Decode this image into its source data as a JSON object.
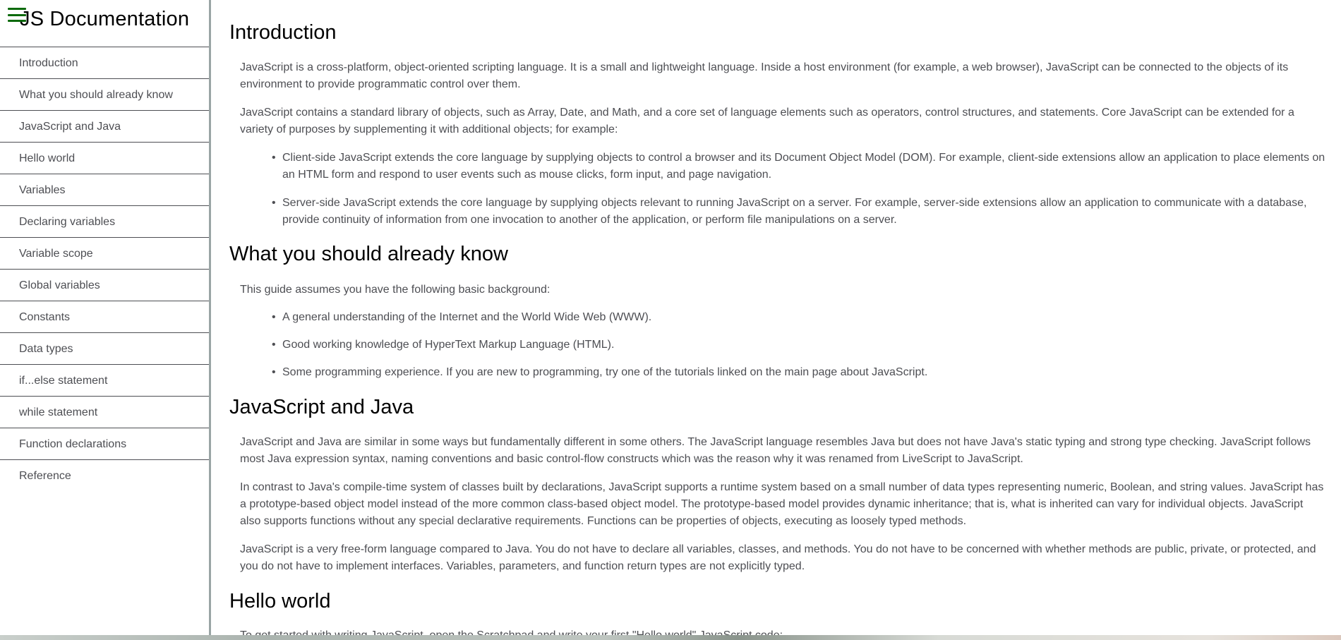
{
  "nav": {
    "title": "JS Documentation",
    "menu_icon": "hamburger-menu-icon",
    "items": [
      {
        "label": "Introduction"
      },
      {
        "label": "What you should already know"
      },
      {
        "label": "JavaScript and Java"
      },
      {
        "label": "Hello world"
      },
      {
        "label": "Variables"
      },
      {
        "label": "Declaring variables"
      },
      {
        "label": "Variable scope"
      },
      {
        "label": "Global variables"
      },
      {
        "label": "Constants"
      },
      {
        "label": "Data types"
      },
      {
        "label": "if...else statement"
      },
      {
        "label": "while statement"
      },
      {
        "label": "Function declarations"
      },
      {
        "label": "Reference"
      }
    ]
  },
  "sections": {
    "introduction": {
      "heading": "Introduction",
      "p1": "JavaScript is a cross-platform, object-oriented scripting language. It is a small and lightweight language. Inside a host environment (for example, a web browser), JavaScript can be connected to the objects of its environment to provide programmatic control over them.",
      "p2": "JavaScript contains a standard library of objects, such as Array, Date, and Math, and a core set of language elements such as operators, control structures, and statements. Core JavaScript can be extended for a variety of purposes by supplementing it with additional objects; for example:",
      "bullets": [
        "Client-side JavaScript extends the core language by supplying objects to control a browser and its Document Object Model (DOM). For example, client-side extensions allow an application to place elements on an HTML form and respond to user events such as mouse clicks, form input, and page navigation.",
        "Server-side JavaScript extends the core language by supplying objects relevant to running JavaScript on a server. For example, server-side extensions allow an application to communicate with a database, provide continuity of information from one invocation to another of the application, or perform file manipulations on a server."
      ]
    },
    "already_know": {
      "heading": "What you should already know",
      "p1": "This guide assumes you have the following basic background:",
      "bullets": [
        "A general understanding of the Internet and the World Wide Web (WWW).",
        "Good working knowledge of HyperText Markup Language (HTML).",
        "Some programming experience. If you are new to programming, try one of the tutorials linked on the main page about JavaScript."
      ]
    },
    "js_java": {
      "heading": "JavaScript and Java",
      "p1": "JavaScript and Java are similar in some ways but fundamentally different in some others. The JavaScript language resembles Java but does not have Java's static typing and strong type checking. JavaScript follows most Java expression syntax, naming conventions and basic control-flow constructs which was the reason why it was renamed from LiveScript to JavaScript.",
      "p2": "In contrast to Java's compile-time system of classes built by declarations, JavaScript supports a runtime system based on a small number of data types representing numeric, Boolean, and string values. JavaScript has a prototype-based object model instead of the more common class-based object model. The prototype-based model provides dynamic inheritance; that is, what is inherited can vary for individual objects. JavaScript also supports functions without any special declarative requirements. Functions can be properties of objects, executing as loosely typed methods.",
      "p3": "JavaScript is a very free-form language compared to Java. You do not have to declare all variables, classes, and methods. You do not have to be concerned with whether methods are public, private, or protected, and you do not have to implement interfaces. Variables, parameters, and function return types are not explicitly typed."
    },
    "hello_world": {
      "heading": "Hello world",
      "p1": "To get started with writing JavaScript, open the Scratchpad and write your first \"Hello world\" JavaScript code:"
    }
  },
  "colors": {
    "menu_icon": "#0b6a0b",
    "text": "#4d4e53",
    "heading": "#000000",
    "sidebar_border": "#9aa5a5"
  }
}
